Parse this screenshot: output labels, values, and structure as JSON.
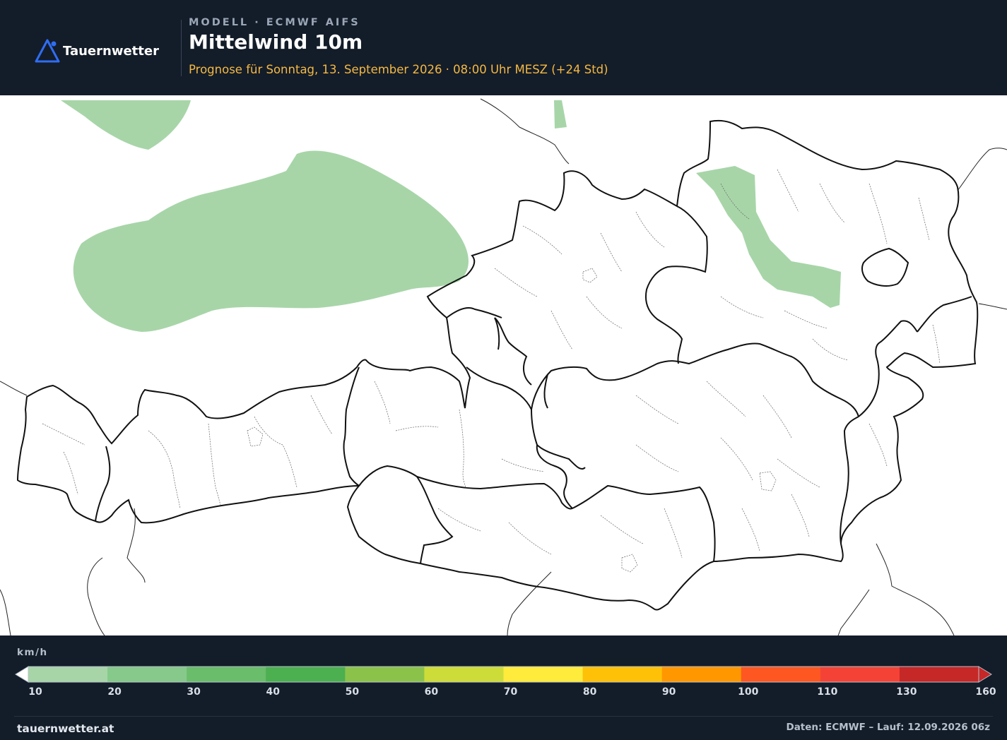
{
  "brand": {
    "name": "Tauernwetter",
    "logo_icon": "mountain-triangle-icon",
    "accent": "#2f6df2"
  },
  "header": {
    "model_line": "MODELL · ECMWF AIFS",
    "title": "Mittelwind 10m",
    "forecast_line": "Prognose für Sonntag, 13. September 2026 · 08:00 Uhr MESZ  (+24 Std)"
  },
  "map": {
    "region": "Austria",
    "layer": "mean wind speed at 10 m",
    "shaded_areas": [
      {
        "area": "far north-west corner (southern Germany)",
        "wind_class_kmh": "10-20",
        "color": "#a7d5a8"
      },
      {
        "area": "Bavaria, north of Tyrol/Salzburg",
        "wind_class_kmh": "10-20",
        "color": "#a7d5a8"
      },
      {
        "area": "narrow strip near northern border",
        "wind_class_kmh": "10-20",
        "color": "#a7d5a8"
      },
      {
        "area": "Lower Austria band, Waldviertel towards Tulln",
        "wind_class_kmh": "10-20",
        "color": "#a7d5a8"
      }
    ]
  },
  "legend": {
    "unit": "km/h",
    "ticks": [
      "10",
      "20",
      "30",
      "40",
      "50",
      "60",
      "70",
      "80",
      "90",
      "100",
      "110",
      "130",
      "160"
    ],
    "colors": [
      "#a7d5a8",
      "#86c98a",
      "#69bd6b",
      "#4caf50",
      "#8bc34a",
      "#cddc39",
      "#ffeb3b",
      "#ffc107",
      "#ff9800",
      "#ff5722",
      "#f44336",
      "#c62828"
    ],
    "under_color": "#ffffff",
    "over_color": "#c62828"
  },
  "footer": {
    "site": "tauernwetter.at",
    "credits": "Daten: ECMWF – Lauf: 12.09.2026 06z"
  }
}
